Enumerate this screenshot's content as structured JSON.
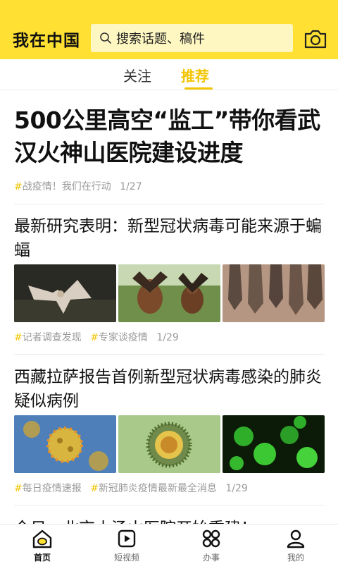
{
  "header": {
    "logo": "我在中国",
    "search_placeholder": "搜索话题、稿件"
  },
  "tabs": [
    {
      "label": "关注"
    },
    {
      "label": "推荐"
    }
  ],
  "feed": {
    "headline": {
      "title": "500公里高空“监工”带你看武汉火神山医院建设进度",
      "tags": [
        "战疫情！我们在行动"
      ],
      "date": "1/27"
    },
    "articles": [
      {
        "title": "最新研究表明：新型冠状病毒可能来源于蝙蝠",
        "tags": [
          "记者调查发现",
          "专家谈疫情"
        ],
        "date": "1/29"
      },
      {
        "title": "西藏拉萨报告首例新型冠状病毒感染的肺炎疑似病例",
        "tags": [
          "每日疫情速报",
          "新冠肺炎疫情最新最全消息"
        ],
        "date": "1/29"
      }
    ],
    "partial_title": "今日，北京小汤山医院开始重建！"
  },
  "bottom_nav": [
    {
      "label": "首页",
      "icon": "home-icon"
    },
    {
      "label": "短视频",
      "icon": "play-icon"
    },
    {
      "label": "办事",
      "icon": "grid-icon"
    },
    {
      "label": "我的",
      "icon": "user-icon"
    }
  ],
  "colors": {
    "brand_yellow": "#FFE033",
    "accent": "#F2C500"
  }
}
